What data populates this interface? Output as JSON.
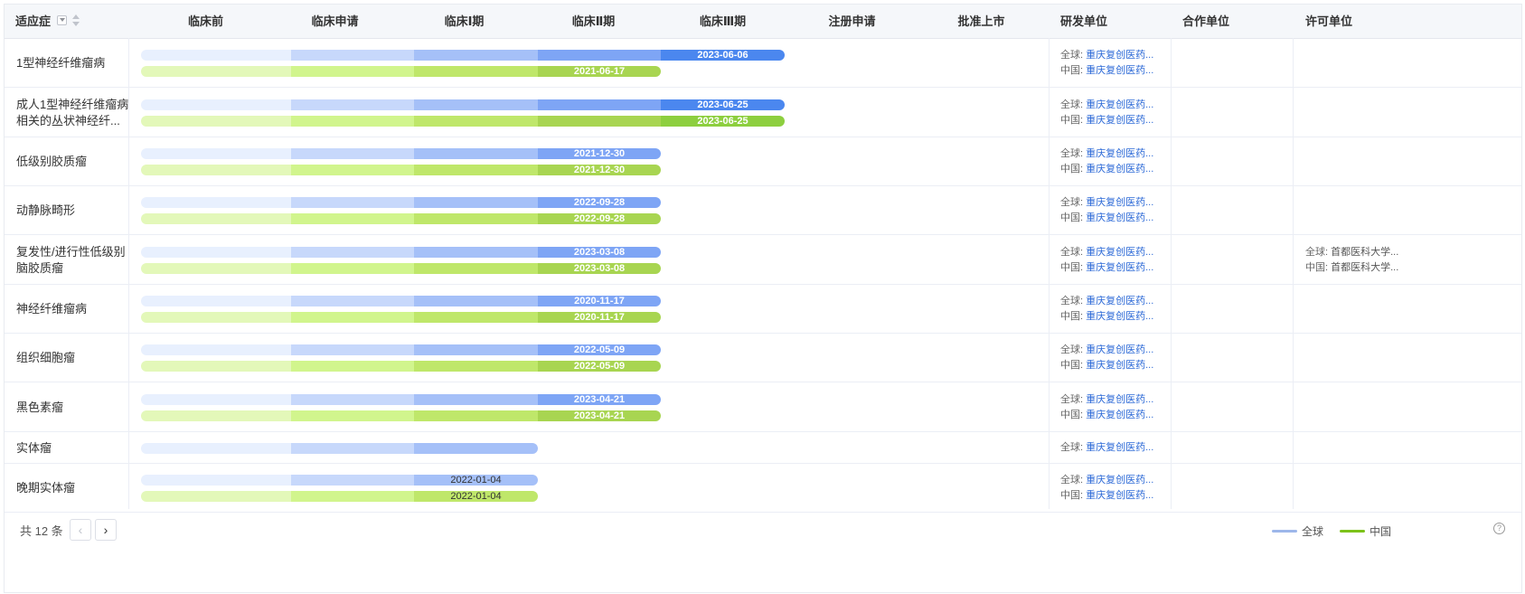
{
  "colors": {
    "global": [
      "#e8f0fe",
      "#c7d8fb",
      "#a5c0f8",
      "#7ea5f5",
      "#4b87ef"
    ],
    "china": [
      "#e3f8b9",
      "#d1f58d",
      "#bfe76a",
      "#a8d551",
      "#8dcf3f"
    ],
    "legend_global": "#9db7ea",
    "legend_china": "#7cc21a"
  },
  "header": {
    "indication": "适应症",
    "phases": [
      "临床前",
      "临床申请",
      "临床Ⅰ期",
      "临床Ⅱ期",
      "临床Ⅲ期",
      "注册申请",
      "批准上市"
    ],
    "developer": "研发单位",
    "partner": "合作单位",
    "licensor": "许可单位"
  },
  "region_labels": {
    "global": "全球:",
    "china": "中国:"
  },
  "rows": [
    {
      "indication": [
        "1型神经纤维瘤病"
      ],
      "bars": [
        {
          "region": "global",
          "stage": 5,
          "date": "2023-06-06",
          "bold": true
        },
        {
          "region": "china",
          "stage": 4,
          "date": "2021-06-17",
          "bold": true
        }
      ],
      "developer": [
        {
          "region": "global",
          "name": "重庆复创医药..."
        },
        {
          "region": "china",
          "name": "重庆复创医药..."
        }
      ],
      "licensor": []
    },
    {
      "indication": [
        "成人1型神经纤维瘤病",
        "相关的丛状神经纤..."
      ],
      "bars": [
        {
          "region": "global",
          "stage": 5,
          "date": "2023-06-25",
          "bold": true
        },
        {
          "region": "china",
          "stage": 5,
          "date": "2023-06-25",
          "bold": true
        }
      ],
      "developer": [
        {
          "region": "global",
          "name": "重庆复创医药..."
        },
        {
          "region": "china",
          "name": "重庆复创医药..."
        }
      ],
      "licensor": []
    },
    {
      "indication": [
        "低级别胶质瘤"
      ],
      "bars": [
        {
          "region": "global",
          "stage": 4,
          "date": "2021-12-30",
          "bold": true
        },
        {
          "region": "china",
          "stage": 4,
          "date": "2021-12-30",
          "bold": true
        }
      ],
      "developer": [
        {
          "region": "global",
          "name": "重庆复创医药..."
        },
        {
          "region": "china",
          "name": "重庆复创医药..."
        }
      ],
      "licensor": []
    },
    {
      "indication": [
        "动静脉畸形"
      ],
      "bars": [
        {
          "region": "global",
          "stage": 4,
          "date": "2022-09-28",
          "bold": true
        },
        {
          "region": "china",
          "stage": 4,
          "date": "2022-09-28",
          "bold": true
        }
      ],
      "developer": [
        {
          "region": "global",
          "name": "重庆复创医药..."
        },
        {
          "region": "china",
          "name": "重庆复创医药..."
        }
      ],
      "licensor": []
    },
    {
      "indication": [
        "复发性/进行性低级别",
        "脑胶质瘤"
      ],
      "bars": [
        {
          "region": "global",
          "stage": 4,
          "date": "2023-03-08",
          "bold": true
        },
        {
          "region": "china",
          "stage": 4,
          "date": "2023-03-08",
          "bold": true
        }
      ],
      "developer": [
        {
          "region": "global",
          "name": "重庆复创医药..."
        },
        {
          "region": "china",
          "name": "重庆复创医药..."
        }
      ],
      "licensor": [
        {
          "region": "global",
          "name": "首都医科大学..."
        },
        {
          "region": "china",
          "name": "首都医科大学..."
        }
      ]
    },
    {
      "indication": [
        "神经纤维瘤病"
      ],
      "bars": [
        {
          "region": "global",
          "stage": 4,
          "date": "2020-11-17",
          "bold": true
        },
        {
          "region": "china",
          "stage": 4,
          "date": "2020-11-17",
          "bold": true
        }
      ],
      "developer": [
        {
          "region": "global",
          "name": "重庆复创医药..."
        },
        {
          "region": "china",
          "name": "重庆复创医药..."
        }
      ],
      "licensor": []
    },
    {
      "indication": [
        "组织细胞瘤"
      ],
      "bars": [
        {
          "region": "global",
          "stage": 4,
          "date": "2022-05-09",
          "bold": true
        },
        {
          "region": "china",
          "stage": 4,
          "date": "2022-05-09",
          "bold": true
        }
      ],
      "developer": [
        {
          "region": "global",
          "name": "重庆复创医药..."
        },
        {
          "region": "china",
          "name": "重庆复创医药..."
        }
      ],
      "licensor": []
    },
    {
      "indication": [
        "黑色素瘤"
      ],
      "bars": [
        {
          "region": "global",
          "stage": 4,
          "date": "2023-04-21",
          "bold": true
        },
        {
          "region": "china",
          "stage": 4,
          "date": "2023-04-21",
          "bold": true
        }
      ],
      "developer": [
        {
          "region": "global",
          "name": "重庆复创医药..."
        },
        {
          "region": "china",
          "name": "重庆复创医药..."
        }
      ],
      "licensor": []
    },
    {
      "indication": [
        "实体瘤"
      ],
      "bars": [
        {
          "region": "global",
          "stage": 3,
          "date": "",
          "bold": false
        }
      ],
      "developer": [
        {
          "region": "global",
          "name": "重庆复创医药..."
        }
      ],
      "licensor": []
    },
    {
      "indication": [
        "晚期实体瘤"
      ],
      "bars": [
        {
          "region": "global",
          "stage": 3,
          "date": "2022-01-04",
          "bold": false
        },
        {
          "region": "china",
          "stage": 3,
          "date": "2022-01-04",
          "bold": false
        }
      ],
      "developer": [
        {
          "region": "global",
          "name": "重庆复创医药..."
        },
        {
          "region": "china",
          "name": "重庆复创医药..."
        }
      ],
      "licensor": []
    }
  ],
  "footer": {
    "total": "共 12 条",
    "prev_icon": "chevron-left-icon",
    "next_icon": "chevron-right-icon",
    "legend_global": "全球",
    "legend_china": "中国",
    "help_icon": "question-circle-icon"
  }
}
